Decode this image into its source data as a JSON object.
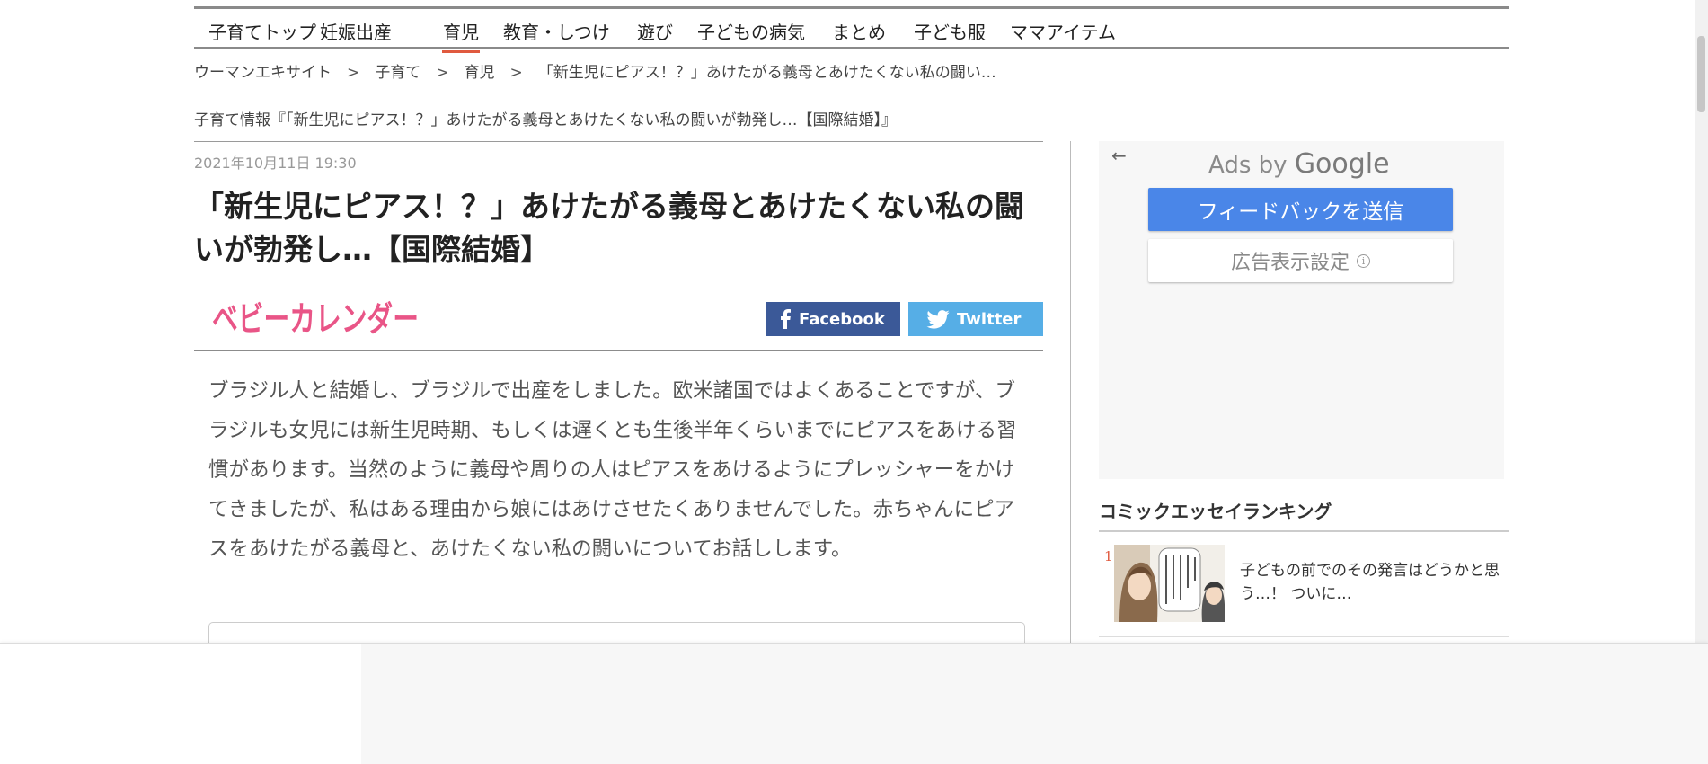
{
  "nav": {
    "items": [
      {
        "label": "子育てトップ",
        "active": false
      },
      {
        "label": "妊娠出産",
        "active": false
      },
      {
        "label": "育児",
        "active": true
      },
      {
        "label": "教育・しつけ",
        "active": false
      },
      {
        "label": "遊び",
        "active": false
      },
      {
        "label": "子どもの病気",
        "active": false
      },
      {
        "label": "まとめ",
        "active": false
      },
      {
        "label": "子ども服",
        "active": false
      },
      {
        "label": "ママアイテム",
        "active": false
      }
    ],
    "accent_color": "#e05a3f"
  },
  "breadcrumb": {
    "items": [
      "ウーマンエキサイト",
      "子育て",
      "育児",
      "「新生児にピアス！？」あけたがる義母とあけたくない私の闘い…"
    ],
    "separator": ">"
  },
  "info_line": "子育て情報『「新生児にピアス！？」あけたがる義母とあけたくない私の闘いが勃発し…【国際結婚】』",
  "article": {
    "date": "2021年10月11日 19:30",
    "title": "「新生児にピアス！？」あけたがる義母とあけたくない私の闘いが勃発し…【国際結婚】",
    "logo_text": "ベビーカレンダー",
    "logo_color": "#e95587",
    "share": {
      "facebook_label": "Facebook",
      "facebook_color": "#3b5998",
      "twitter_label": "Twitter",
      "twitter_color": "#56aee6"
    },
    "lead": "ブラジル人と結婚し、ブラジルで出産をしました。欧米諸国ではよくあることですが、ブラジルも女児には新生児時期、もしくは遅くとも生後半年くらいまでにピアスをあける習慣があります。当然のように義母や周りの人はピアスをあけるようにプレッシャーをかけてきましたが、私はある理由から娘にはあけさせたくありませんでした。赤ちゃんにピアスをあけたがる義母と、あけたくない私の闘いについてお話しします。"
  },
  "ad": {
    "back_icon": "arrow-left-icon",
    "ads_by": "Ads by",
    "google": "Google",
    "feedback_label": "フィードバックを送信",
    "settings_label": "広告表示設定",
    "info_icon": "info-icon",
    "button_color": "#4a86e8"
  },
  "ranking": {
    "title": "コミックエッセイランキング",
    "items": [
      {
        "rank": "1",
        "text": "子どもの前でのその発言はどうかと思う…！ ついに…"
      }
    ]
  }
}
